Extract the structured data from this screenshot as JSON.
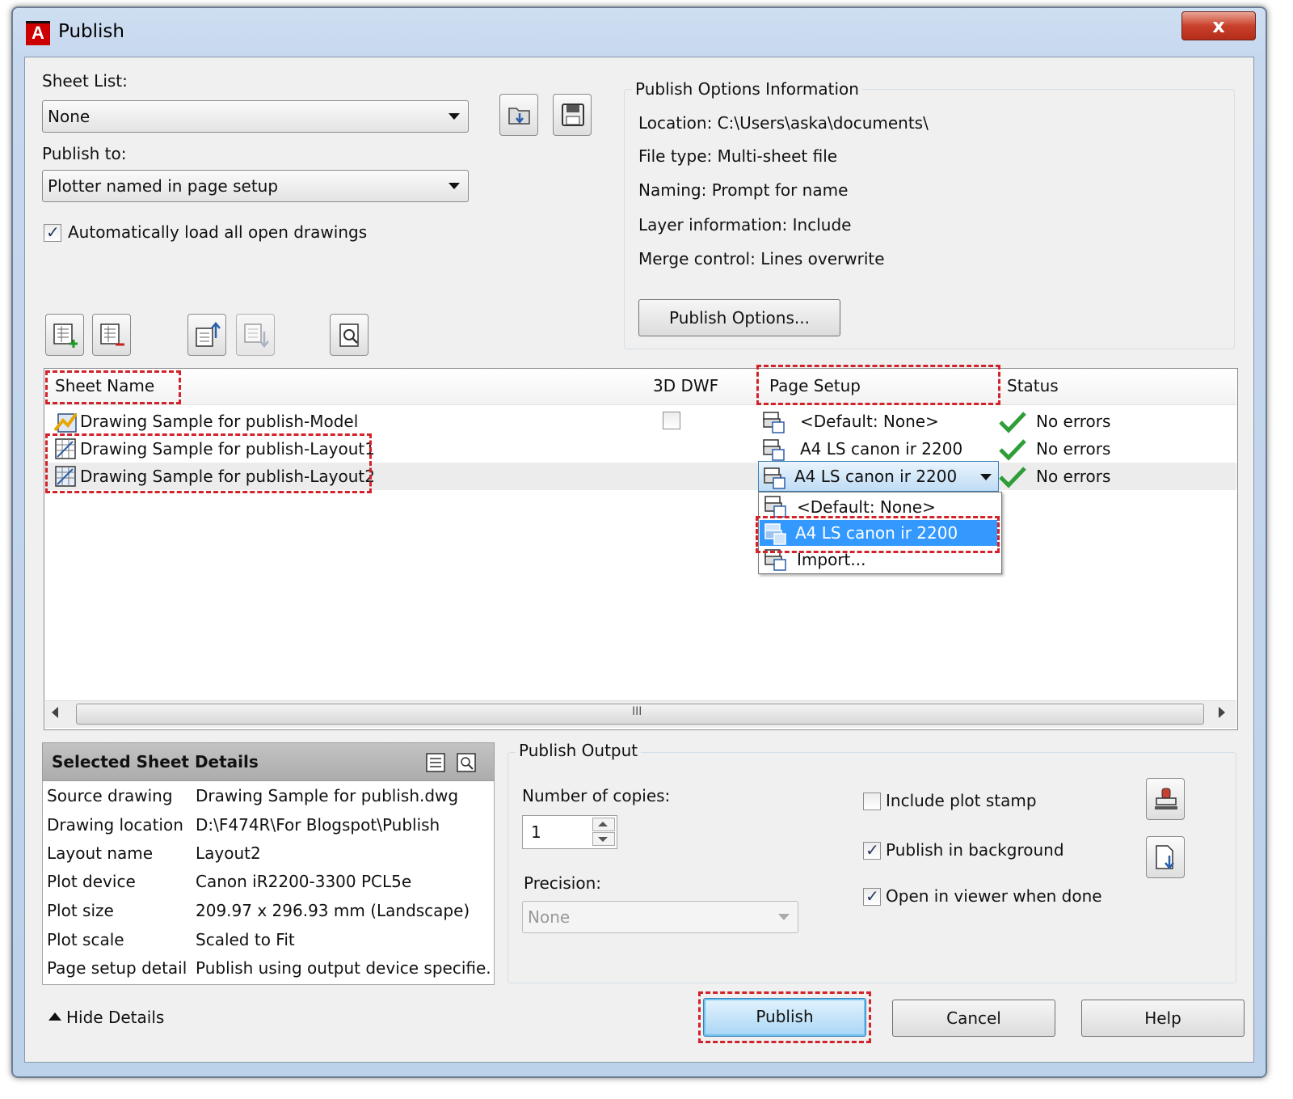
{
  "window": {
    "title": "Publish",
    "close_label": "x"
  },
  "sheet_list": {
    "label": "Sheet List:",
    "value": "None"
  },
  "publish_to": {
    "label": "Publish to:",
    "value": "Plotter named in page setup"
  },
  "auto_load": {
    "label": "Automatically load all open drawings",
    "checked": true
  },
  "options_info": {
    "title": "Publish Options Information",
    "location": "Location:  C:\\Users\\aska\\documents\\",
    "file_type": "File type:  Multi-sheet file",
    "naming": "Naming:  Prompt for name",
    "layer_info": "Layer information:  Include",
    "merge_control": "Merge control:  Lines overwrite",
    "button": "Publish Options..."
  },
  "columns": {
    "sheet_name": "Sheet Name",
    "dwf3d": "3D DWF",
    "page_setup": "Page Setup",
    "status": "Status"
  },
  "rows": [
    {
      "name": "Drawing Sample for publish-Model",
      "page_setup": "<Default: None>",
      "status": "No errors"
    },
    {
      "name": "Drawing Sample for publish-Layout1",
      "page_setup": "A4 LS canon ir 2200",
      "status": "No errors"
    },
    {
      "name": "Drawing Sample for publish-Layout2",
      "page_setup": "A4 LS canon ir 2200",
      "status": "No errors"
    }
  ],
  "dropdown": {
    "items": [
      "<Default: None>",
      "A4 LS canon ir 2200",
      "Import..."
    ],
    "selected": "A4 LS canon ir 2200"
  },
  "scroll_grip": "III",
  "details": {
    "title": "Selected Sheet Details",
    "labels": [
      "Source drawing",
      "Drawing location",
      "Layout name",
      "Plot device",
      "Plot size",
      "Plot scale",
      "Page setup detail"
    ],
    "values": [
      "Drawing Sample for publish.dwg",
      "D:\\F474R\\For Blogspot\\Publish",
      "Layout2",
      "Canon iR2200-3300 PCL5e",
      "209.97 x 296.93 mm (Landscape)",
      "Scaled to Fit",
      "Publish using output device specifie..."
    ]
  },
  "output": {
    "title": "Publish Output",
    "copies_label": "Number of copies:",
    "copies_value": "1",
    "precision_label": "Precision:",
    "precision_value": "None",
    "plot_stamp": {
      "label": "Include plot stamp",
      "checked": false
    },
    "background": {
      "label": "Publish in background",
      "checked": true
    },
    "viewer": {
      "label": "Open in viewer when done",
      "checked": true
    }
  },
  "footer": {
    "hide_details": "Hide Details",
    "publish": "Publish",
    "cancel": "Cancel",
    "help": "Help"
  },
  "colors": {
    "highlight": "#3399ff",
    "annotation_red": "#d2232a",
    "check_green": "#2f9e3a"
  }
}
